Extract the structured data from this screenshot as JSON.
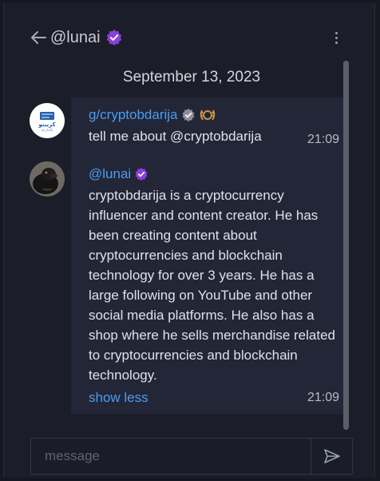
{
  "header": {
    "title": "@lunai",
    "back_icon": "arrow-left-icon",
    "verified_icon": "verified-badge-icon",
    "menu_icon": "more-vertical-icon"
  },
  "conversation": {
    "date": "September 13, 2023",
    "messages": [
      {
        "author": "g/cryptobdarija",
        "body": "tell me about @cryptobdarija",
        "time": "21:09",
        "avatar_text": "كريبتو بالدارجة"
      },
      {
        "author": "@lunai",
        "body": "cryptobdarija is a cryptocurrency influencer and content creator. He has been creating content about cryptocurrencies and blockchain technology for over 3 years. He has a large following on YouTube and other social media platforms. He also has a shop where he sells merchandise related to cryptocurrencies and blockchain technology.",
        "time": "21:09",
        "toggle_label": "show less"
      }
    ]
  },
  "composer": {
    "placeholder": "message",
    "send_icon": "send-icon"
  },
  "colors": {
    "background": "#1b1e29",
    "bubble": "#222637",
    "link": "#4d9cf0",
    "verified_purple": "#8b3fd9",
    "verified_gray": "#8c8f96"
  }
}
